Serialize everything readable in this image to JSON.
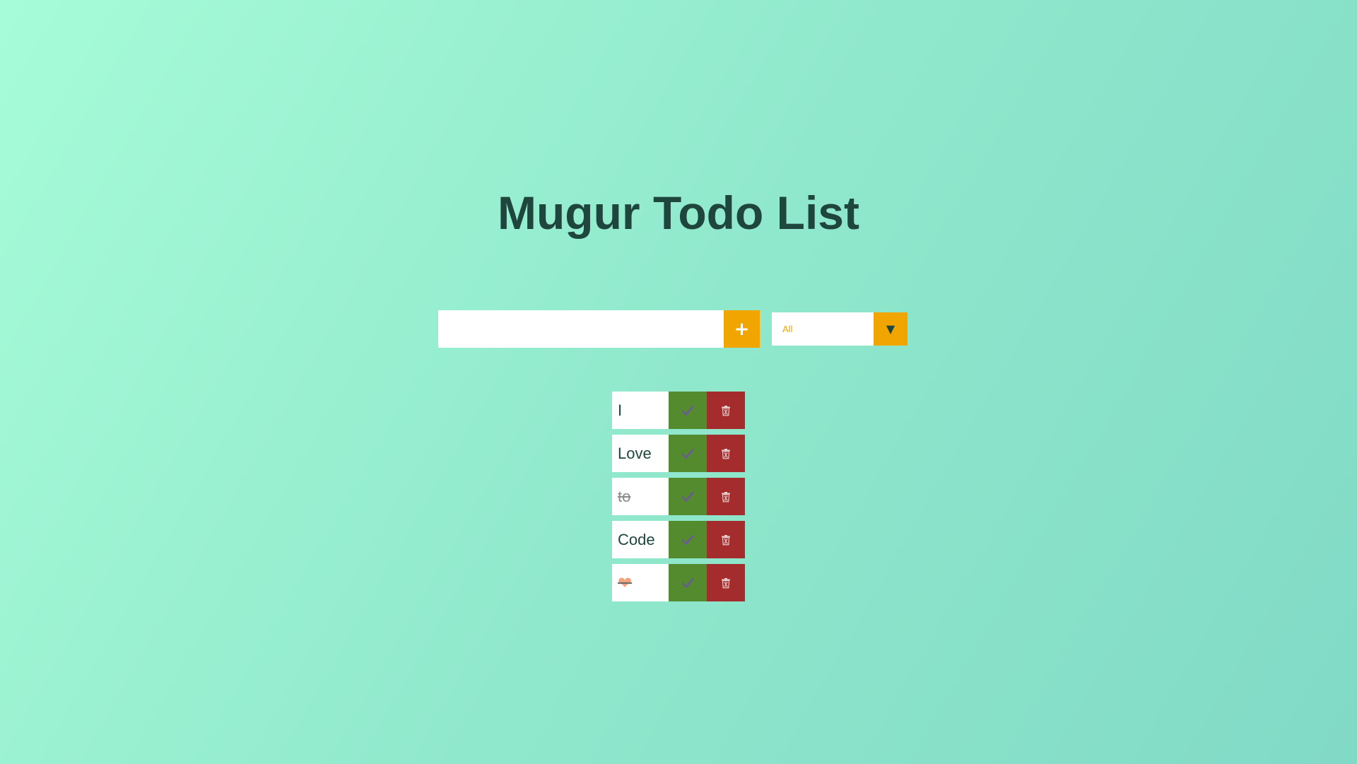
{
  "app": {
    "title": "Mugur Todo List"
  },
  "form": {
    "input_value": "",
    "input_placeholder": "",
    "add_icon": "plus-icon",
    "add_glyph": "+"
  },
  "filter": {
    "selected": "All",
    "arrow_icon": "caret-down-icon",
    "arrow_glyph": "▼"
  },
  "todos": [
    {
      "text": "I",
      "completed": false
    },
    {
      "text": "Love",
      "completed": false
    },
    {
      "text": "to",
      "completed": true
    },
    {
      "text": "Code",
      "completed": false
    },
    {
      "text": "❤",
      "completed": true,
      "is_emoji": true
    }
  ],
  "colors": {
    "title": "#1f463d",
    "accent": "#f0a500",
    "complete": "#558b2f",
    "trash": "#a52c2c",
    "check_icon": "#6b5b95",
    "heart": "#f4a27e"
  },
  "icons": {
    "complete": "check-icon",
    "trash": "trash-icon"
  }
}
